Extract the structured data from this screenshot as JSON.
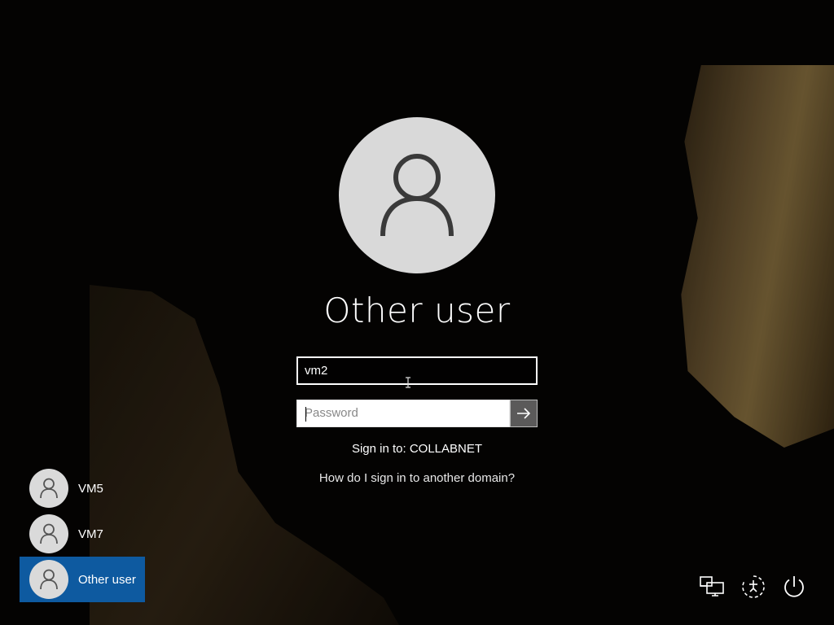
{
  "login": {
    "user_title": "Other user",
    "username_value": "vm2",
    "password_placeholder": "Password",
    "sign_in_to": "Sign in to: COLLABNET",
    "domain_link": "How do I sign in to another domain?"
  },
  "user_list": [
    {
      "name": "VM5",
      "selected": false
    },
    {
      "name": "VM7",
      "selected": false
    },
    {
      "name": "Other user",
      "selected": true
    }
  ],
  "system_icons": [
    "network-icon",
    "ease-of-access-icon",
    "power-icon"
  ],
  "colors": {
    "selected_user_bg": "#0e5aa0",
    "avatar_bg": "#d9d9d9",
    "avatar_glyph": "#3a3a3a"
  }
}
